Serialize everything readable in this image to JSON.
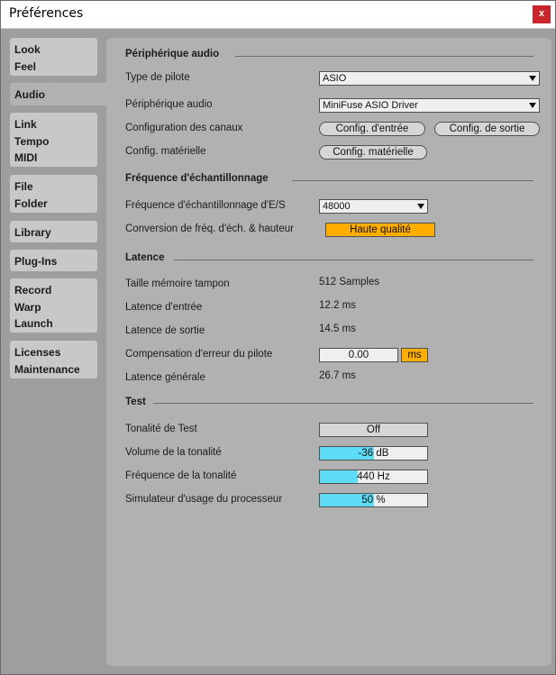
{
  "window": {
    "title": "Préférences",
    "close_label": "x"
  },
  "sidebar": {
    "tabs": [
      {
        "lines": [
          "Look",
          "Feel"
        ]
      },
      {
        "lines": [
          "Audio"
        ]
      },
      {
        "lines": [
          "Link",
          "Tempo",
          "MIDI"
        ]
      },
      {
        "lines": [
          "File",
          "Folder"
        ]
      },
      {
        "lines": [
          "Library"
        ]
      },
      {
        "lines": [
          "Plug-Ins"
        ]
      },
      {
        "lines": [
          "Record",
          "Warp",
          "Launch"
        ]
      },
      {
        "lines": [
          "Licenses",
          "Maintenance"
        ]
      }
    ],
    "active_tab": "Audio"
  },
  "device": {
    "section_title": "Périphérique audio",
    "driver_label": "Type de pilote",
    "driver_value": "ASIO",
    "device_label": "Périphérique audio",
    "device_value": "MiniFuse ASIO Driver",
    "channels_label": "Configuration des canaux",
    "input_config_button": "Config. d'entrée",
    "output_config_button": "Config. de sortie",
    "hardware_label": "Config. matérielle",
    "hardware_button": "Config. matérielle"
  },
  "sample_rate": {
    "section_title": "Fréquence d'échantillonnage",
    "io_rate_label": "Fréquence d'échantillonnage d'E/S",
    "io_rate_value": "48000",
    "conversion_label": "Conversion de fréq. d'éch. & hauteur",
    "conversion_value": "Haute qualité"
  },
  "latency": {
    "section_title": "Latence",
    "buffer_label": "Taille mémoire tampon",
    "buffer_value": "512 Samples",
    "input_label": "Latence d'entrée",
    "input_value": "12.2 ms",
    "output_label": "Latence de sortie",
    "output_value": "14.5 ms",
    "comp_label": "Compensation d'erreur du pilote",
    "comp_value": "0.00",
    "comp_unit": "ms",
    "overall_label": "Latence générale",
    "overall_value": "26.7 ms"
  },
  "test": {
    "section_title": "Test",
    "tone_label": "Tonalité de Test",
    "tone_value": "Off",
    "volume_label": "Volume de la tonalité",
    "volume_value": "-36 dB",
    "volume_level": 0.5,
    "freq_label": "Fréquence de la tonalité",
    "freq_value": "440 Hz",
    "freq_level": 0.35,
    "cpu_label": "Simulateur d'usage du processeur",
    "cpu_value": "50 %",
    "cpu_level": 0.5
  },
  "colors": {
    "accent_orange": "#ffae00",
    "slider_fill": "#5fdcf5",
    "close_red": "#c8262a"
  }
}
